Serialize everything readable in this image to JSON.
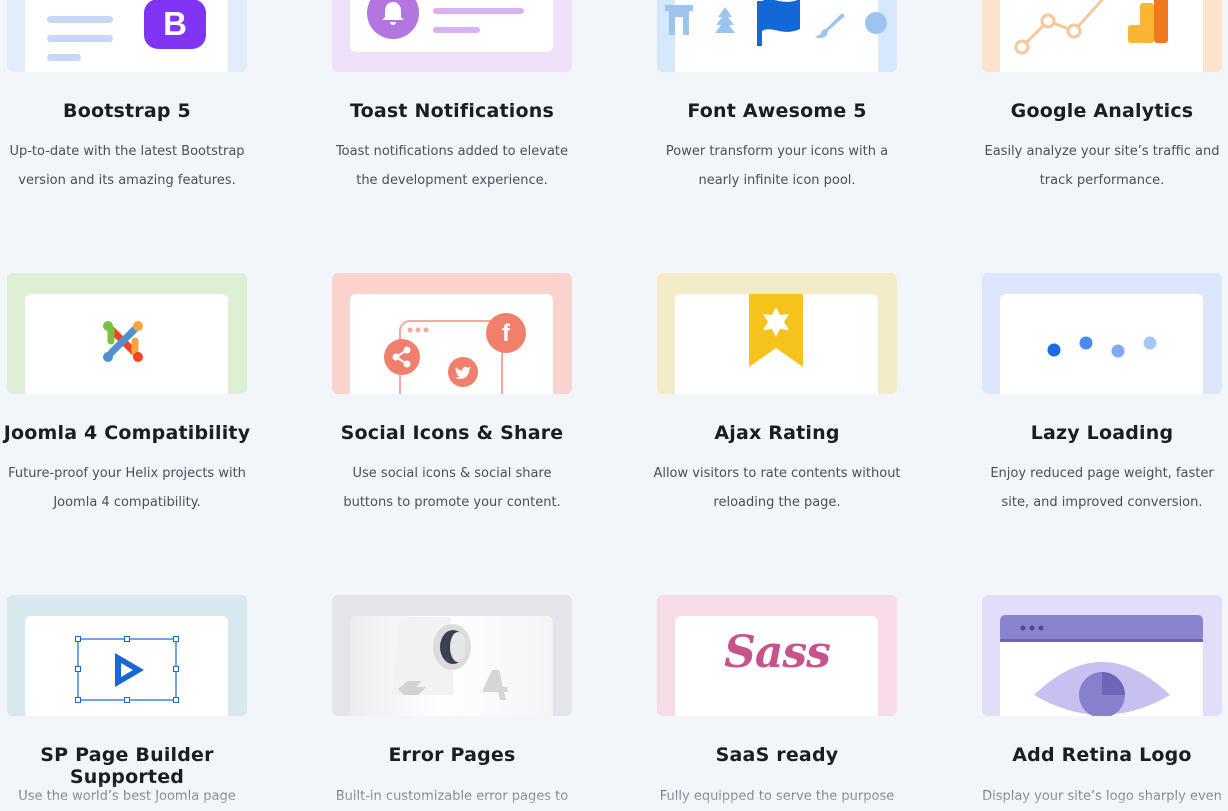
{
  "features": [
    {
      "title": "Bootstrap 5",
      "desc1": "Up-to-date with the latest Bootstrap",
      "desc2": "version and its amazing features."
    },
    {
      "title": "Toast Notifications",
      "desc1": "Toast notifications added to elevate",
      "desc2": "the development experience."
    },
    {
      "title": "Font Awesome 5",
      "desc1": "Power transform your icons with a",
      "desc2": "nearly infinite icon pool."
    },
    {
      "title": "Google Analytics",
      "desc1": "Easily analyze your site’s traffic and",
      "desc2": "track performance."
    },
    {
      "title": "Joomla 4 Compatibility",
      "desc1": "Future-proof your Helix projects with",
      "desc2": "Joomla 4 compatibility."
    },
    {
      "title": "Social Icons & Share",
      "desc1": "Use social icons & social share",
      "desc2": "buttons to promote your content."
    },
    {
      "title": "Ajax Rating",
      "desc1": "Allow visitors to rate contents without",
      "desc2": "reloading the page."
    },
    {
      "title": "Lazy Loading",
      "desc1": "Enjoy reduced page weight, faster",
      "desc2": "site, and improved conversion."
    },
    {
      "title": "SP Page Builder Supported",
      "desc1": "Use the world’s best Joomla page",
      "desc2": ""
    },
    {
      "title": "Error Pages",
      "desc1": "Built-in customizable error pages to",
      "desc2": ""
    },
    {
      "title": "SaaS ready",
      "desc1": "Fully equipped to serve the purpose",
      "desc2": ""
    },
    {
      "title": "Add Retina Logo",
      "desc1": "Display your site’s logo sharply even",
      "desc2": ""
    }
  ],
  "icons": {
    "bootstrap_letter": "B",
    "sass_word": "Sass"
  },
  "colors": {
    "bootstrap_bg": "#e4ecfb",
    "toast_bg": "#f0e1fa",
    "fontawesome_bg": "#d6e8fb",
    "analytics_bg": "#fde3cb",
    "joomla_bg": "#dfefd6",
    "social_bg": "#fbd3ce",
    "rating_bg": "#f4ebc9",
    "lazy_bg": "#dde6fc",
    "builder_bg": "#d8e8ef",
    "error_bg": "#e3e5ea",
    "sass_bg": "#f7dbe6",
    "retina_bg": "#e1defa"
  }
}
